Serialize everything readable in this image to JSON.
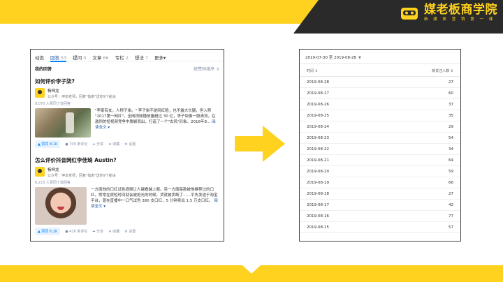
{
  "brand": {
    "title": "媒老板商学院",
    "subtitle": "新 媒 体 营 销 第 一 课",
    "colors": {
      "yellow": "#ffd21f",
      "dark": "#2a2a2a",
      "accent_blue": "#0084ff"
    }
  },
  "zhihu": {
    "tabs": [
      {
        "label": "动态",
        "count": ""
      },
      {
        "label": "回答",
        "count": "53"
      },
      {
        "label": "提问",
        "count": "0"
      },
      {
        "label": "文章",
        "count": "66"
      },
      {
        "label": "专栏",
        "count": "2"
      },
      {
        "label": "想法",
        "count": "7"
      },
      {
        "label": "更多",
        "count": ""
      }
    ],
    "more_caret": "▾",
    "section_title": "我的回答",
    "sort_label": "按赞同排序 ⇕",
    "answers": [
      {
        "question": "如何评价李子柒?",
        "author": "杨坤龙",
        "author_desc": "公众号：坤龙老师，回复\"指南\"送你9个秘诀",
        "agree_text": "8,070 人赞同了该回答",
        "excerpt": "\"李家有女，人称子柒。\" 李子柒不是网红脸，也不露大长腿，但入称 \"2017第一网红\"。全网视频播放量超过 30 亿，李子柒像一股清流，在激烈的短视频竞争中脱颖而出，打造了一个\"古风\"形象。2016年8...",
        "read_more": "阅读全文 ▾",
        "vote": "▲ 赞同 8.1K",
        "actions": [
          "● 709 条评论",
          "➦ 分享",
          "★ 收藏",
          "⚙ 设置"
        ]
      },
      {
        "question": "怎么评价抖音网红李佳琦 Austin?",
        "author": "杨坤龙",
        "author_desc": "公众号：坤龙老师，回复\"指南\"送你9个秘诀",
        "agree_text": "6,223 人赞同了该回答",
        "excerpt": "一方面他的口红试色视频让人越看越上瘾。另一方面每款被他推荐过的口红，常常在很短时间就会被抢光的时候。货就被卖断了……平先发迹于淘宝平台，曾在直播中一口气试色 380 支口红，5 分钟卖出 1.5 万支口红。",
        "read_more": "阅读全文 ▾",
        "vote": "▲ 赞同 6.2K",
        "actions": [
          "● 416 条评论",
          "➦ 分享",
          "★ 收藏",
          "⚙ 设置"
        ]
      }
    ]
  },
  "stats": {
    "date_range": "2019-07-30 至 2019-08-28",
    "date_caret": "▼",
    "headers": [
      "时间 ⇕",
      "新关注人数 ⇕"
    ],
    "rows": [
      {
        "date": "2019-08-28",
        "value": "27"
      },
      {
        "date": "2019-08-27",
        "value": "60"
      },
      {
        "date": "2019-08-26",
        "value": "37"
      },
      {
        "date": "2019-08-25",
        "value": "35"
      },
      {
        "date": "2019-08-24",
        "value": "29"
      },
      {
        "date": "2019-08-23",
        "value": "54"
      },
      {
        "date": "2019-08-22",
        "value": "34"
      },
      {
        "date": "2019-08-21",
        "value": "64"
      },
      {
        "date": "2019-08-20",
        "value": "59"
      },
      {
        "date": "2019-08-19",
        "value": "66"
      },
      {
        "date": "2019-08-18",
        "value": "27"
      },
      {
        "date": "2019-08-17",
        "value": "42"
      },
      {
        "date": "2019-08-16",
        "value": "77"
      },
      {
        "date": "2019-08-15",
        "value": "57"
      }
    ]
  }
}
